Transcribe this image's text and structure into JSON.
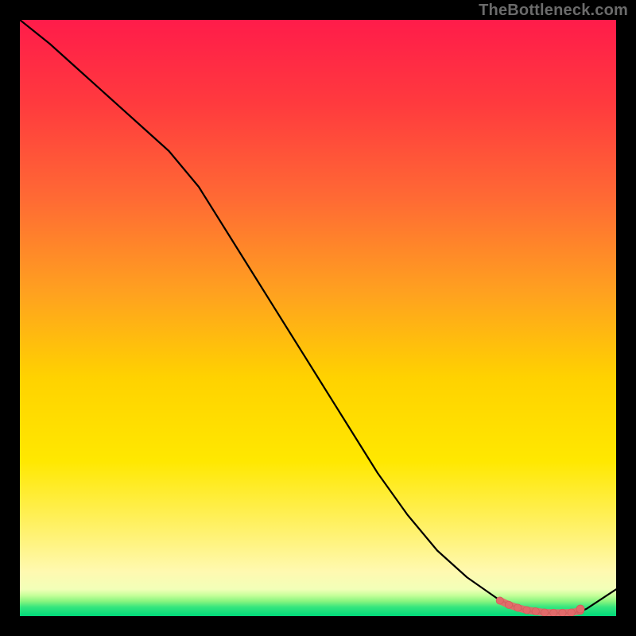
{
  "watermark": "TheBottleneck.com",
  "colors": {
    "gradient_top": "#ff1c4a",
    "gradient_mid_upper": "#ff8a2e",
    "gradient_mid": "#ffe800",
    "gradient_low": "#fff9b0",
    "gradient_bottom": "#00d97a",
    "line": "#000000",
    "marker_fill": "#e26a6a",
    "marker_stroke": "#d45a5a"
  },
  "chart_data": {
    "type": "line",
    "title": "",
    "xlabel": "",
    "ylabel": "",
    "xlim": [
      0,
      100
    ],
    "ylim": [
      0,
      100
    ],
    "grid": false,
    "legend": false,
    "series": [
      {
        "name": "curve",
        "x": [
          0,
          5,
          10,
          15,
          20,
          25,
          30,
          35,
          40,
          45,
          50,
          55,
          60,
          65,
          70,
          75,
          80,
          82,
          84,
          86,
          88,
          90,
          92,
          93,
          95,
          100
        ],
        "y": [
          100,
          96,
          91.5,
          87,
          82.5,
          78,
          72,
          64,
          56,
          48,
          40,
          32,
          24,
          17,
          11,
          6.5,
          3,
          2,
          1.2,
          0.7,
          0.5,
          0.5,
          0.5,
          0.5,
          1.2,
          4.5
        ]
      }
    ],
    "markers": {
      "name": "highlight-dots",
      "x": [
        80.5,
        82,
        83.5,
        85,
        86.5,
        88,
        89.5,
        91,
        92.5,
        94
      ],
      "y": [
        2.6,
        1.9,
        1.4,
        1.0,
        0.8,
        0.6,
        0.55,
        0.55,
        0.6,
        0.9
      ]
    },
    "marker_isolated": {
      "x": 94,
      "y": 1.2
    }
  }
}
